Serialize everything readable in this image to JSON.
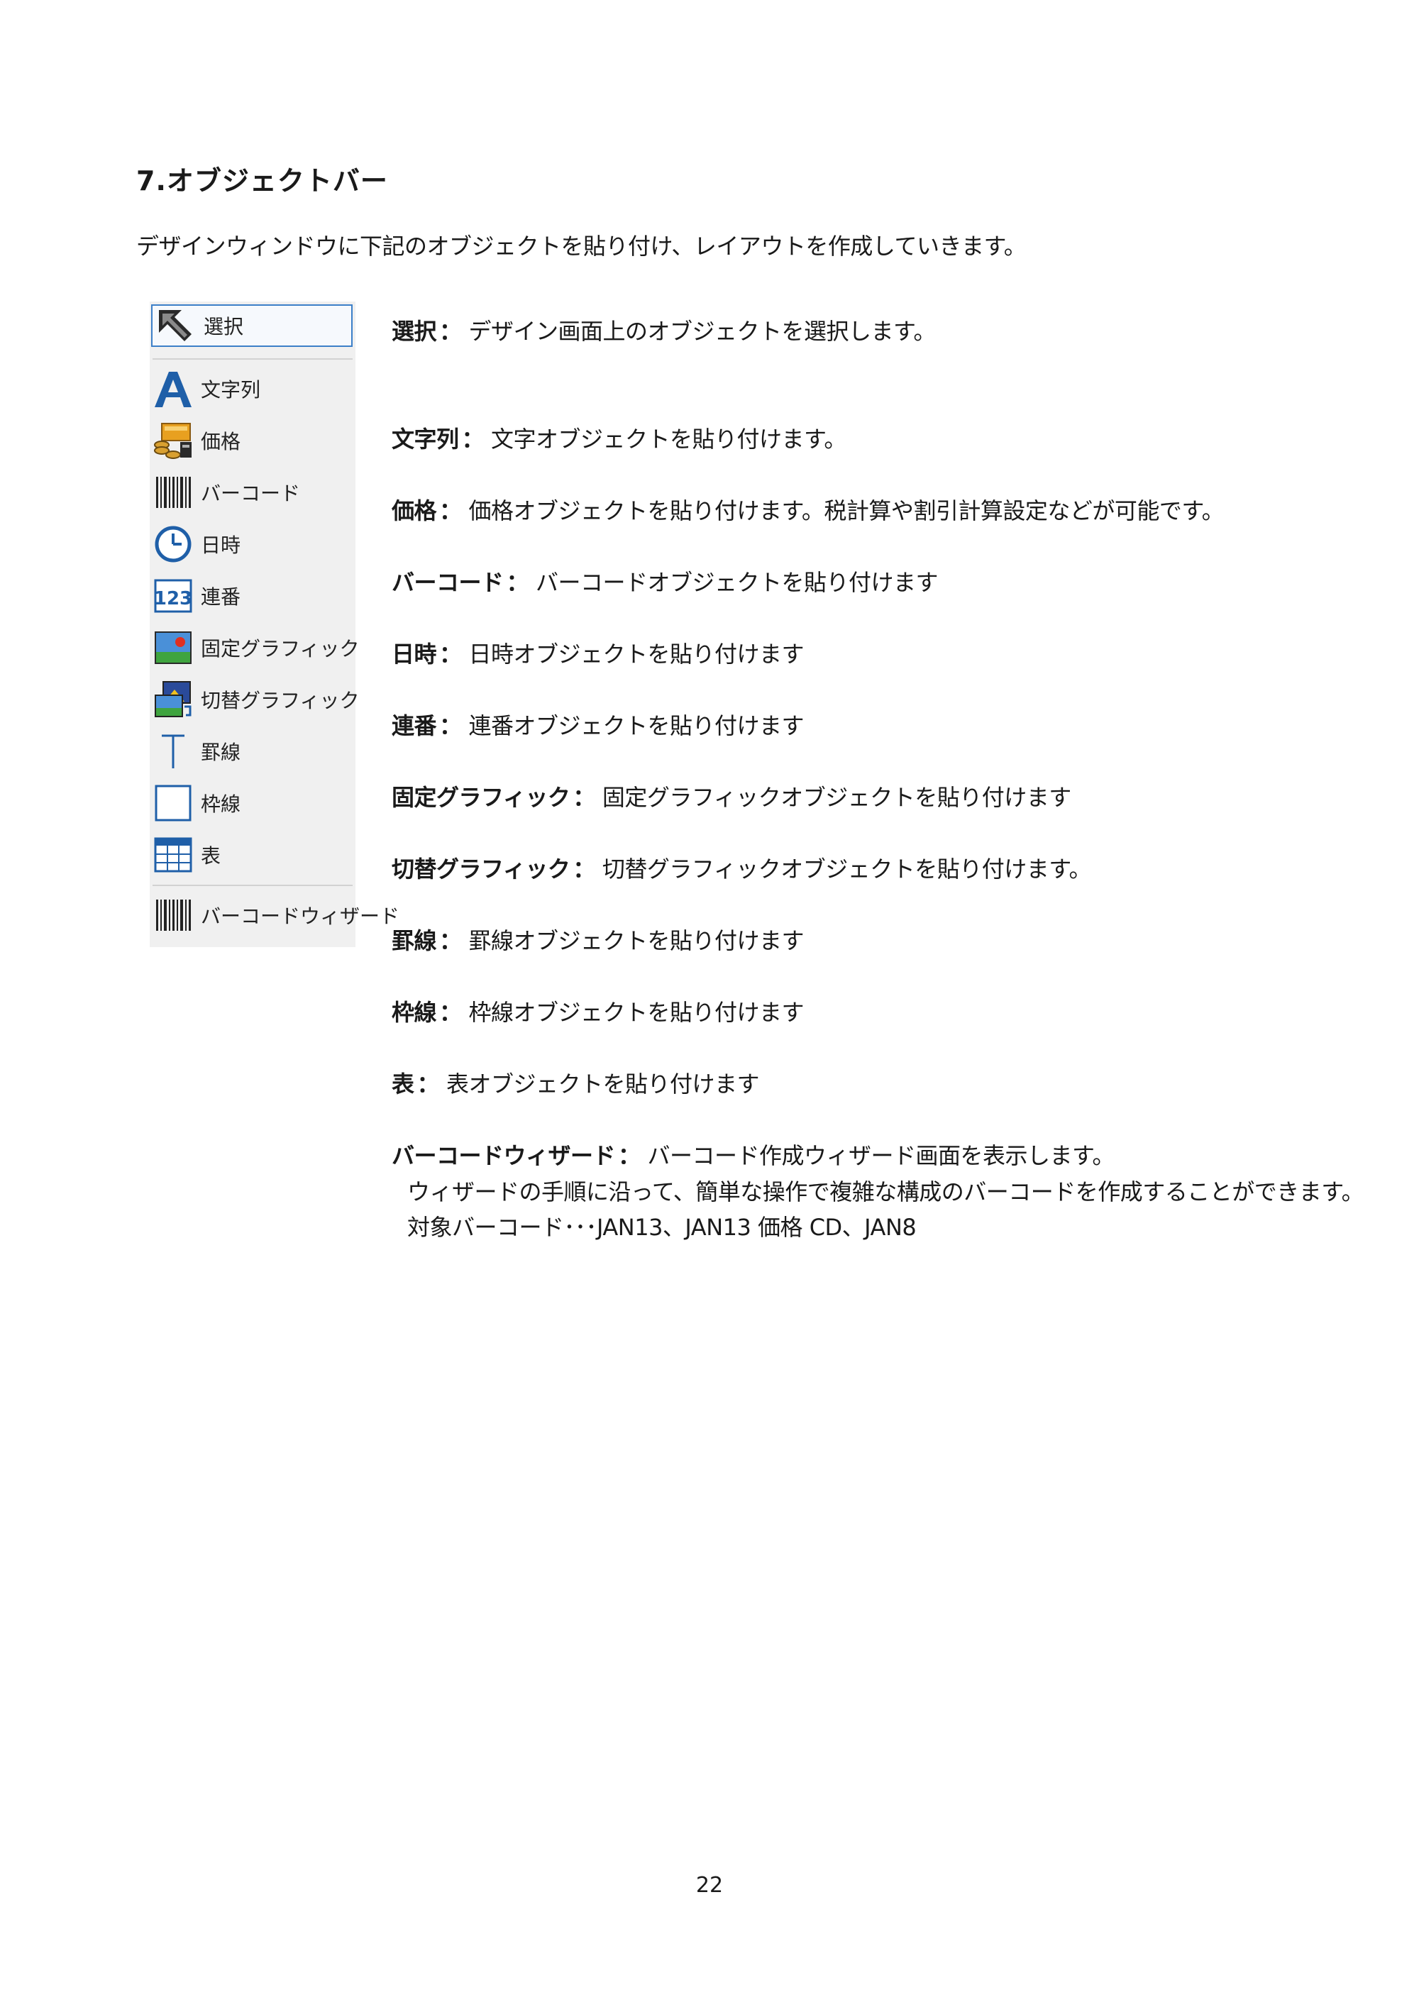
{
  "title": "7.オブジェクトバー",
  "intro": "デザインウィンドウに下記のオブジェクトを貼り付け、レイアウトを作成していきます。",
  "toolbar": {
    "items": [
      {
        "label": "選択",
        "icon": "select-arrow-icon"
      },
      {
        "label": "文字列",
        "icon": "text-a-icon"
      },
      {
        "label": "価格",
        "icon": "price-coins-icon"
      },
      {
        "label": "バーコード",
        "icon": "barcode-icon"
      },
      {
        "label": "日時",
        "icon": "clock-icon"
      },
      {
        "label": "連番",
        "icon": "serial-123-icon"
      },
      {
        "label": "固定グラフィック",
        "icon": "image-icon"
      },
      {
        "label": "切替グラフィック",
        "icon": "switch-image-icon"
      },
      {
        "label": "罫線",
        "icon": "line-icon"
      },
      {
        "label": "枠線",
        "icon": "rectangle-icon"
      },
      {
        "label": "表",
        "icon": "table-icon"
      },
      {
        "label": "バーコードウィザード",
        "icon": "barcode-wizard-icon"
      }
    ],
    "colors": {
      "accent": "#3c7fc8",
      "panel": "#f0f0f0"
    }
  },
  "descriptions": [
    {
      "term": "選択",
      "colon": "：",
      "text": "デザイン画面上のオブジェクトを選択します。"
    },
    {
      "term": "文字列",
      "colon": "：",
      "text": "文字オブジェクトを貼り付けます。"
    },
    {
      "term": "価格",
      "colon": "：",
      "text": "価格オブジェクトを貼り付けます。税計算や割引計算設定などが可能です。"
    },
    {
      "term": "バーコード",
      "colon": "：",
      "text": "バーコードオブジェクトを貼り付けます"
    },
    {
      "term": "日時",
      "colon": "：",
      "text": "日時オブジェクトを貼り付けます"
    },
    {
      "term": "連番",
      "colon": "：",
      "text": "連番オブジェクトを貼り付けます"
    },
    {
      "term": "固定グラフィック",
      "colon": "：",
      "text": "固定グラフィックオブジェクトを貼り付けます"
    },
    {
      "term": "切替グラフィック",
      "colon": "：",
      "text": "切替グラフィックオブジェクトを貼り付けます。"
    },
    {
      "term": "罫線",
      "colon": "：",
      "text": "罫線オブジェクトを貼り付けます"
    },
    {
      "term": "枠線",
      "colon": "：",
      "text": "枠線オブジェクトを貼り付けます"
    },
    {
      "term": "表",
      "colon": "：",
      "text": "表オブジェクトを貼り付けます"
    },
    {
      "term": "バーコードウィザード",
      "colon": "：",
      "text": "バーコード作成ウィザード画面を表示します。"
    }
  ],
  "wizard_notes": [
    "ウィザードの手順に沿って、簡単な操作で複雑な構成のバーコードを作成することができます。",
    "対象バーコード･･･JAN13、JAN13 価格 CD、JAN8"
  ],
  "page_number": "22"
}
